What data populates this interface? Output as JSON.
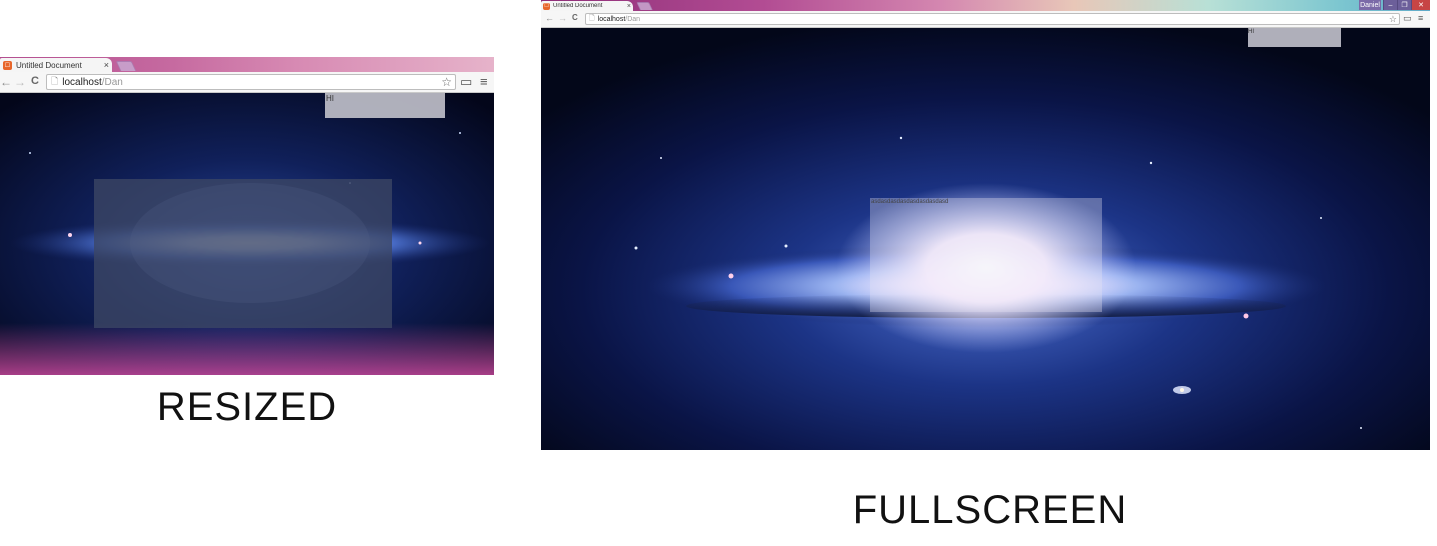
{
  "resized": {
    "tab": {
      "favicon_glyph": "☐",
      "title": "Untitled Document",
      "close": "×"
    },
    "toolbar": {
      "back": "←",
      "forward": "→",
      "reload": "C",
      "page_icon": "🗋",
      "url_host": "localhost",
      "url_path": "/Dan",
      "star": "☆",
      "cast": "▭",
      "menu": "≡"
    },
    "page": {
      "hi_text": "HI",
      "box_text": ""
    },
    "caption": "RESIZED"
  },
  "fullscreen": {
    "tab": {
      "favicon_glyph": "☐",
      "title": "Untitled Document",
      "close": "×"
    },
    "window": {
      "profile_name": "Daniel",
      "minimize": "–",
      "restore": "❐",
      "close": "✕"
    },
    "toolbar": {
      "back": "←",
      "forward": "→",
      "reload": "C",
      "page_icon": "🗋",
      "url_host": "localhost",
      "url_path": "/Dan",
      "star": "☆",
      "cast": "▭",
      "menu": "≡"
    },
    "page": {
      "hi_text": "HI",
      "box_text": "asdasdasdasdasdasdasdasd"
    },
    "caption": "FULLSCREEN"
  },
  "colors": {
    "favicon": "#e8662a",
    "space_dark": "#04071c",
    "galaxy_glow": "#f5e8ff",
    "overlay_grey": "#bebec8"
  },
  "icons": {
    "back": "arrow-left-icon",
    "forward": "arrow-right-icon",
    "reload": "reload-icon",
    "page": "page-icon",
    "star": "star-icon",
    "cast": "cast-icon",
    "menu": "hamburger-menu-icon",
    "favicon": "html-file-icon"
  }
}
